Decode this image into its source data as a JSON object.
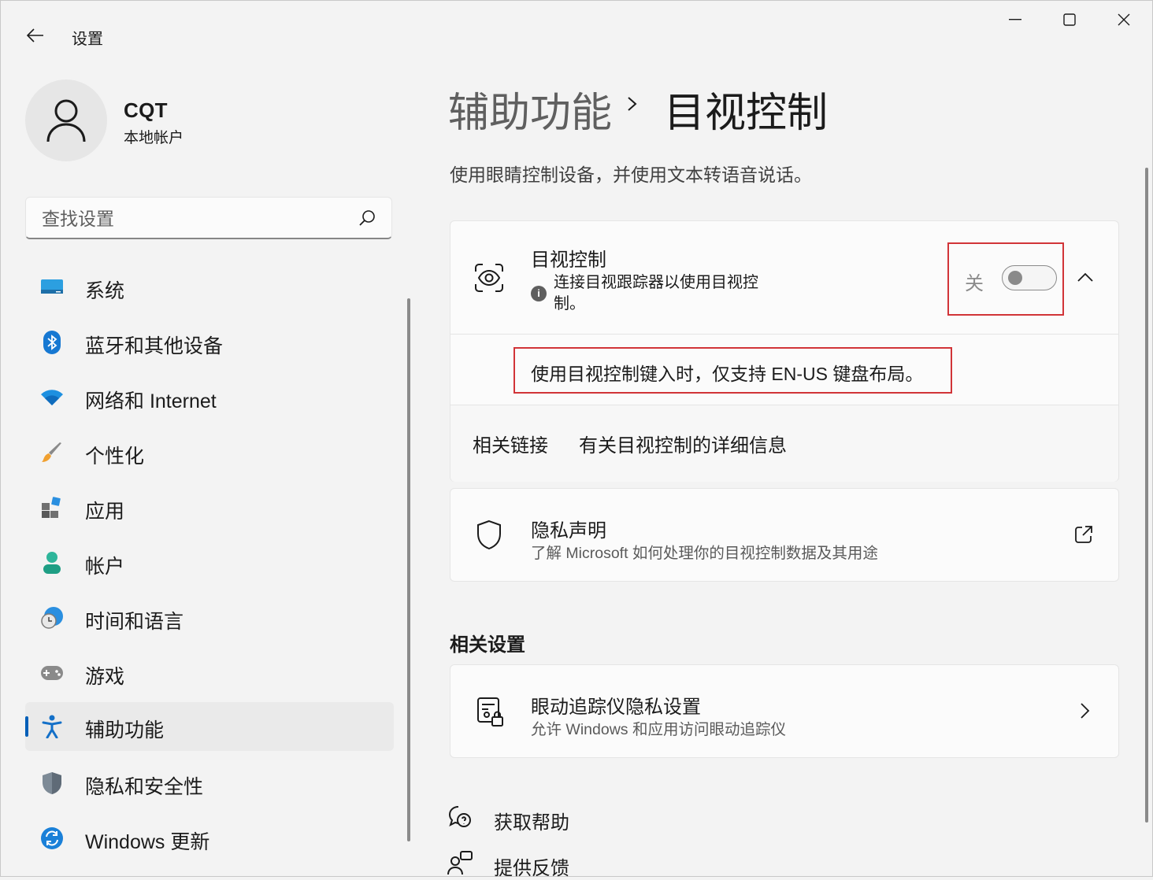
{
  "window": {
    "app_title": "设置"
  },
  "profile": {
    "name": "CQT",
    "account_type": "本地帐户"
  },
  "search": {
    "placeholder": "查找设置"
  },
  "sidebar": {
    "items": [
      {
        "label": "系统",
        "icon": "system-icon",
        "active": false
      },
      {
        "label": "蓝牙和其他设备",
        "icon": "bluetooth-icon",
        "active": false
      },
      {
        "label": "网络和 Internet",
        "icon": "wifi-icon",
        "active": false
      },
      {
        "label": "个性化",
        "icon": "brush-icon",
        "active": false
      },
      {
        "label": "应用",
        "icon": "apps-icon",
        "active": false
      },
      {
        "label": "帐户",
        "icon": "account-icon",
        "active": false
      },
      {
        "label": "时间和语言",
        "icon": "clock-globe-icon",
        "active": false
      },
      {
        "label": "游戏",
        "icon": "gamepad-icon",
        "active": false
      },
      {
        "label": "辅助功能",
        "icon": "accessibility-icon",
        "active": true
      },
      {
        "label": "隐私和安全性",
        "icon": "shield-icon",
        "active": false
      },
      {
        "label": "Windows 更新",
        "icon": "update-icon",
        "active": false
      }
    ]
  },
  "header": {
    "breadcrumb_parent": "辅助功能",
    "breadcrumb_current": "目视控制",
    "description": "使用眼睛控制设备，并使用文本转语音说话。"
  },
  "eye_control": {
    "title": "目视控制",
    "info_line1": "连接目视跟踪器以使用目视控",
    "info_line2": "制。",
    "toggle_state_label": "关",
    "toggle_on": false,
    "note": "使用目视控制键入时，仅支持 EN-US 键盘布局。",
    "related_links_label": "相关链接",
    "related_link": "有关目视控制的详细信息"
  },
  "privacy_card": {
    "title": "隐私声明",
    "subtitle": "了解 Microsoft 如何处理你的目视控制数据及其用途"
  },
  "related_settings": {
    "section_title": "相关设置",
    "items": [
      {
        "title": "眼动追踪仪隐私设置",
        "subtitle": "允许 Windows 和应用访问眼动追踪仪"
      }
    ]
  },
  "footer": {
    "help": "获取帮助",
    "feedback": "提供反馈"
  },
  "colors": {
    "accent": "#005fb8",
    "highlight_border": "#d13438"
  }
}
